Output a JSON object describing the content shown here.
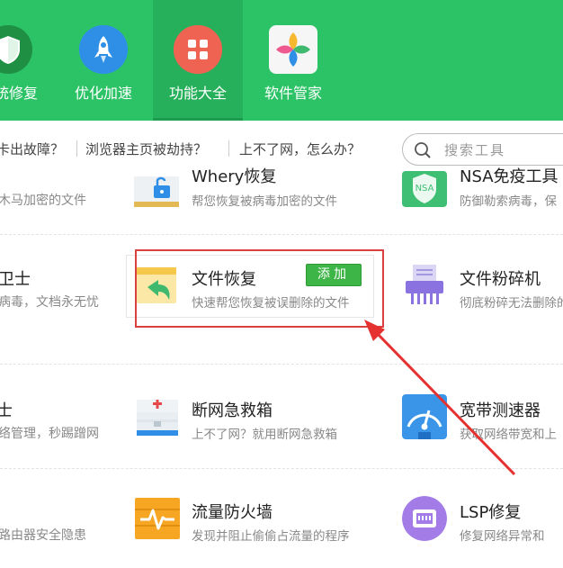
{
  "nav": {
    "items": [
      {
        "label": "统修复"
      },
      {
        "label": "优化加速"
      },
      {
        "label": "功能大全"
      },
      {
        "label": "软件管家"
      }
    ]
  },
  "linkbar": {
    "links": [
      "卡出故障？",
      "浏览器主页被劫持？",
      "上不了网，怎么办？"
    ],
    "search_placeholder": "搜索工具"
  },
  "tools": {
    "row1_left_desc": "木马加密的文件",
    "row1_mid_title": "Whery恢复",
    "row1_mid_desc": "帮您恢复被病毒加密的文件",
    "row1_right_title": "NSA免疫工具",
    "row1_right_desc": "防御勒索病毒，保",
    "row1_right_icon_text": "NSA",
    "row2_left_title": "卫士",
    "row2_left_desc": "病毒，文档永无忧",
    "file_recovery_title": "文件恢复",
    "file_recovery_desc": "快速帮您恢复被误删除的文件",
    "add_label": "添加",
    "shredder_title": "文件粉碎机",
    "shredder_desc": "彻底粉碎无法删除的",
    "row3_left_title": "士",
    "row3_left_desc": "络管理，秒踢蹭网",
    "rescue_title": "断网急救箱",
    "rescue_desc": "上不了网？就用断网急救箱",
    "speed_title": "宽带测速器",
    "speed_desc": "获取网络带宽和上",
    "row4_left_desc": "路由器安全隐患",
    "firewall_title": "流量防火墙",
    "firewall_desc": "发现并阻止偷偷占流量的程序",
    "lsp_title": "LSP修复",
    "lsp_desc": "修复网络异常和"
  },
  "colors": {
    "header_bg": "#2cc366",
    "highlight": "#d9413e",
    "add_button": "#3eb647"
  }
}
